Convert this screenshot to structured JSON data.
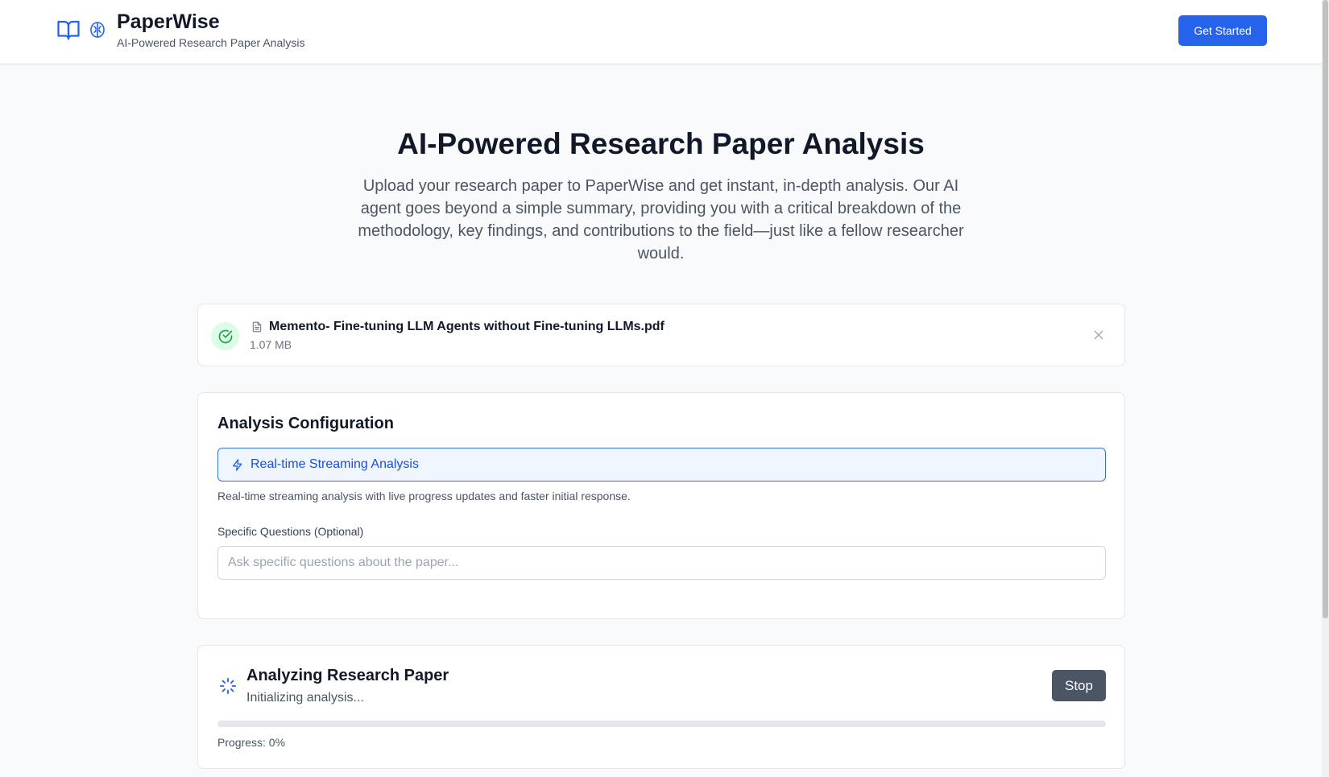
{
  "header": {
    "brand_name": "PaperWise",
    "brand_subtitle": "AI-Powered Research Paper Analysis",
    "cta_label": "Get Started",
    "icons": [
      "book-open-icon",
      "brain-icon"
    ]
  },
  "hero": {
    "title": "AI-Powered Research Paper Analysis",
    "description": "Upload your research paper to PaperWise and get instant, in-depth analysis. Our AI agent goes beyond a simple summary, providing you with a critical breakdown of the methodology, key findings, and contributions to the field—just like a fellow researcher would."
  },
  "file": {
    "name": "Memento- Fine-tuning LLM Agents without Fine-tuning LLMs.pdf",
    "size": "1.07 MB",
    "status_icon": "check-circle-icon"
  },
  "config": {
    "title": "Analysis Configuration",
    "mode_label": "Real-time Streaming Analysis",
    "mode_description": "Real-time streaming analysis with live progress updates and faster initial response.",
    "questions_label": "Specific Questions (Optional)",
    "questions_placeholder": "Ask specific questions about the paper...",
    "questions_value": ""
  },
  "progress": {
    "title": "Analyzing Research Paper",
    "status": "Initializing analysis...",
    "stop_label": "Stop",
    "progress_text": "Progress: 0%",
    "percent": 0
  },
  "colors": {
    "accent": "#2563eb",
    "success_bg": "#dcfce7",
    "success": "#16a34a",
    "stop_bg": "#4b5563"
  }
}
